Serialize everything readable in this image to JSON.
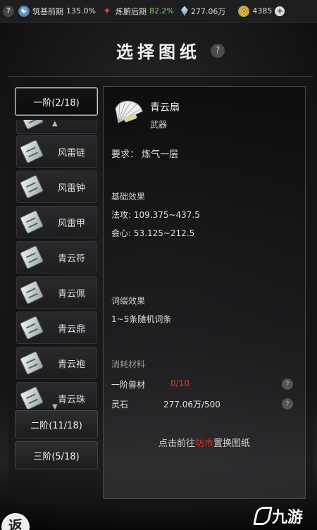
{
  "status_bar": {
    "help_icon": "?",
    "realm1_name": "筑基前期",
    "realm1_progress": "135.0%",
    "realm2_name": "炼腑后期",
    "realm2_progress": "82.2%",
    "spirit_stones": "277.06万",
    "gold": "4385",
    "plus_icon": "+"
  },
  "header": {
    "title": "选择图纸",
    "help_icon": "?"
  },
  "tiers": [
    {
      "label": "一阶(2/18)",
      "active": true
    },
    {
      "label": "二阶(11/18)",
      "active": false
    },
    {
      "label": "三阶(5/18)",
      "active": false
    }
  ],
  "blueprint_list": [
    {
      "label": "风雷链"
    },
    {
      "label": "风雷钟"
    },
    {
      "label": "风雷甲"
    },
    {
      "label": "青云符"
    },
    {
      "label": "青云佩"
    },
    {
      "label": "青云鼎"
    },
    {
      "label": "青云袍"
    },
    {
      "label": "青云珠"
    }
  ],
  "detail": {
    "name": "青云扇",
    "type": "武器",
    "requirement_label": "要求：",
    "requirement_value": "炼气一层",
    "base_effect_title": "基础效果",
    "stat_attack": "法攻: 109.375~437.5",
    "stat_crit": "会心: 53.125~212.5",
    "affix_title": "词缀效果",
    "affix_value": "1~5条随机词条",
    "materials_title": "消耗材料",
    "materials": [
      {
        "name": "一阶兽材",
        "amount": "0/10"
      },
      {
        "name": "灵石",
        "amount": "277.06万/500"
      }
    ],
    "hint_prefix": "点击前往",
    "hint_link": "坊市",
    "hint_suffix": "置换图纸"
  },
  "bottom": {
    "seal_char": "返",
    "logo_text": "九游"
  },
  "colors": {
    "accent_red": "#e2332b",
    "progress_green": "#7fc65a",
    "panel_border": "#4a4a4d"
  }
}
